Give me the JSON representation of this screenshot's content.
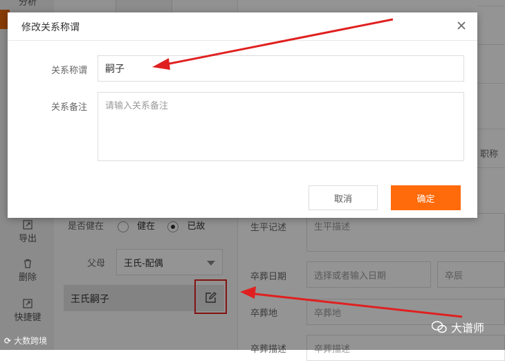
{
  "background": {
    "sidebar": {
      "top_item": "分析",
      "items": [
        {
          "label": "导出",
          "icon": "export-icon"
        },
        {
          "label": "删除",
          "icon": "trash-icon"
        },
        {
          "label": "快捷键",
          "icon": "shortcut-icon"
        }
      ]
    },
    "form": {
      "alive_label": "是否健在",
      "alive_option": "健在",
      "deceased_option": "已故",
      "parent_label": "父母",
      "parent_value": "王氏-配偶",
      "child_name": "王氏嗣子",
      "title_label": "职称",
      "life_label": "生平记述",
      "life_placeholder": "生平描述",
      "burial_date_label": "卒葬日期",
      "burial_date_placeholder": "选择或者输入日期",
      "burial_time_placeholder": "卒辰",
      "burial_place_label": "卒葬地",
      "burial_place_placeholder": "卒葬地",
      "burial_desc_label": "卒葬描述",
      "burial_desc_placeholder": "卒葬描述"
    }
  },
  "modal": {
    "title": "修改关系称谓",
    "relation_label": "关系称谓",
    "relation_value": "嗣子",
    "note_label": "关系备注",
    "note_placeholder": "请输入关系备注",
    "cancel_label": "取消",
    "ok_label": "确定"
  },
  "watermarks": {
    "left": "大数跨境",
    "right": "大谱师"
  },
  "colors": {
    "accent": "#ff6a0a",
    "annotation": "#e02020"
  }
}
